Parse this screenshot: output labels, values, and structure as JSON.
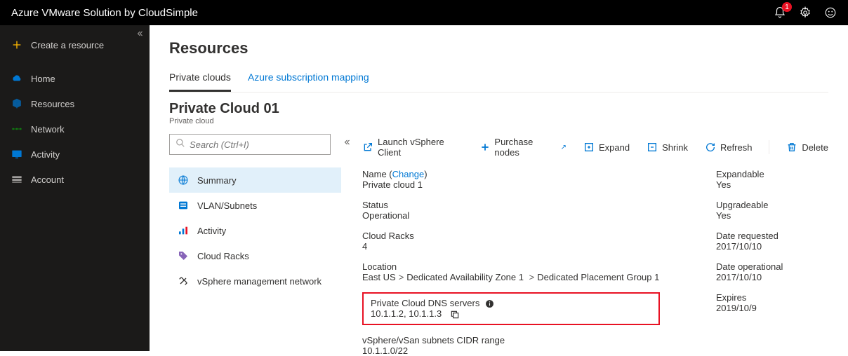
{
  "topbar": {
    "title": "Azure VMware Solution by CloudSimple",
    "notification_count": "1"
  },
  "sidebar": {
    "create": "Create a resource",
    "items": [
      {
        "label": "Home"
      },
      {
        "label": "Resources"
      },
      {
        "label": "Network"
      },
      {
        "label": "Activity"
      },
      {
        "label": "Account"
      }
    ]
  },
  "main": {
    "heading": "Resources",
    "tabs": [
      {
        "label": "Private clouds"
      },
      {
        "label": "Azure subscription mapping"
      }
    ],
    "pc_title": "Private Cloud 01",
    "pc_subtitle": "Private cloud",
    "search_placeholder": "Search (Ctrl+I)",
    "nav": [
      {
        "label": "Summary"
      },
      {
        "label": "VLAN/Subnets"
      },
      {
        "label": "Activity"
      },
      {
        "label": "Cloud Racks"
      },
      {
        "label": "vSphere management network"
      }
    ],
    "toolbar": {
      "launch": "Launch vSphere Client",
      "purchase": "Purchase nodes",
      "expand": "Expand",
      "shrink": "Shrink",
      "refresh": "Refresh",
      "delete": "Delete"
    },
    "details": {
      "name_label": "Name",
      "change": "Change",
      "name_value": "Private cloud 1",
      "status_label": "Status",
      "status_value": "Operational",
      "racks_label": "Cloud Racks",
      "racks_value": "4",
      "location_label": "Location",
      "loc_region": "East US",
      "loc_zone": "Dedicated Availability Zone 1",
      "loc_group": "Dedicated Placement Group 1",
      "dns_label": "Private Cloud DNS servers",
      "dns_value": "10.1.1.2, 10.1.1.3",
      "cidr_label": "vSphere/vSan subnets CIDR range",
      "cidr_value": "10.1.1.0/22",
      "expandable_label": "Expandable",
      "expandable_value": "Yes",
      "upgradeable_label": "Upgradeable",
      "upgradeable_value": "Yes",
      "requested_label": "Date requested",
      "requested_value": "2017/10/10",
      "operational_label": "Date operational",
      "operational_value": "2017/10/10",
      "expires_label": "Expires",
      "expires_value": "2019/10/9"
    }
  }
}
